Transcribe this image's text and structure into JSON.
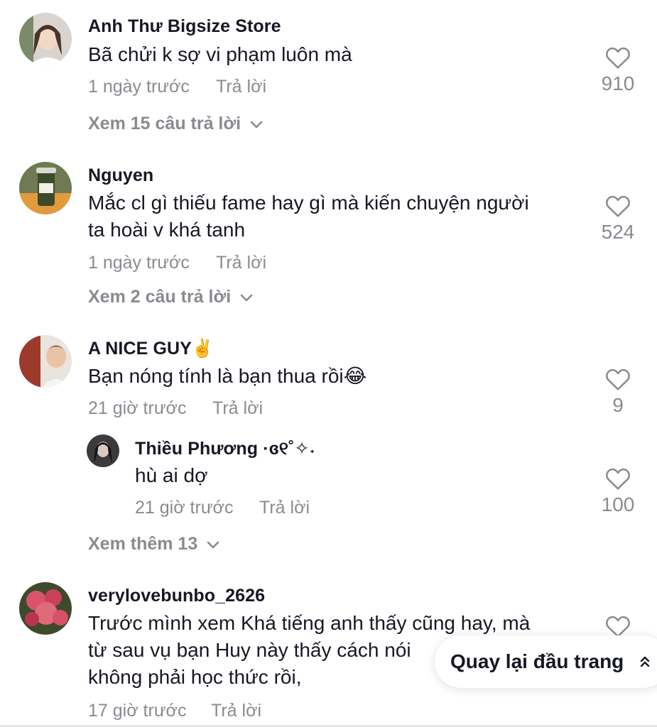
{
  "comments": [
    {
      "username": "Anh Thư Bigsize Store",
      "text": "Bã chửi k sợ vi phạm luôn mà",
      "time": "1 ngày trước",
      "reply_label": "Trả lời",
      "likes": "910",
      "view_replies": "Xem 15 câu trả lời",
      "avatar_icon": "woman-portrait-avatar"
    },
    {
      "username": "Nguyen",
      "text_lines": [
        "Mắc cl gì thiếu fame hay gì mà kiến chuyện người",
        "ta hoài v khá tanh"
      ],
      "time": "1 ngày trước",
      "reply_label": "Trả lời",
      "likes": "524",
      "view_replies": "Xem 2 câu trả lời",
      "avatar_icon": "cup-avatar"
    },
    {
      "username": "A NICE GUY✌️",
      "text": "Bạn nóng tính là bạn thua rồi😂",
      "time": "21 giờ trước",
      "reply_label": "Trả lời",
      "likes": "9",
      "avatar_icon": "man-photo-avatar",
      "replies": [
        {
          "username": "Thiều Phương ·ɞ୧˚✧˖",
          "text": "hù ai dợ",
          "time": "21 giờ trước",
          "reply_label": "Trả lời",
          "likes": "100",
          "avatar_icon": "dark-portrait-avatar"
        }
      ],
      "view_more": "Xem thêm 13"
    },
    {
      "username": "verylovebunbo_2626",
      "text_lines": [
        "Trước mình xem Khá tiếng anh thấy cũng hay, mà",
        "từ sau vụ bạn Huy này thấy cách nói",
        "không phải học thức rồi,"
      ],
      "time": "17 giờ trước",
      "reply_label": "Trả lời",
      "avatar_icon": "flower-avatar"
    }
  ],
  "back_to_top": {
    "label": "Quay lại đầu trang",
    "icon": "double-chevron-up-icon"
  },
  "colors": {
    "text_primary": "#161823",
    "text_secondary": "#8a8b91",
    "background": "#ffffff"
  }
}
